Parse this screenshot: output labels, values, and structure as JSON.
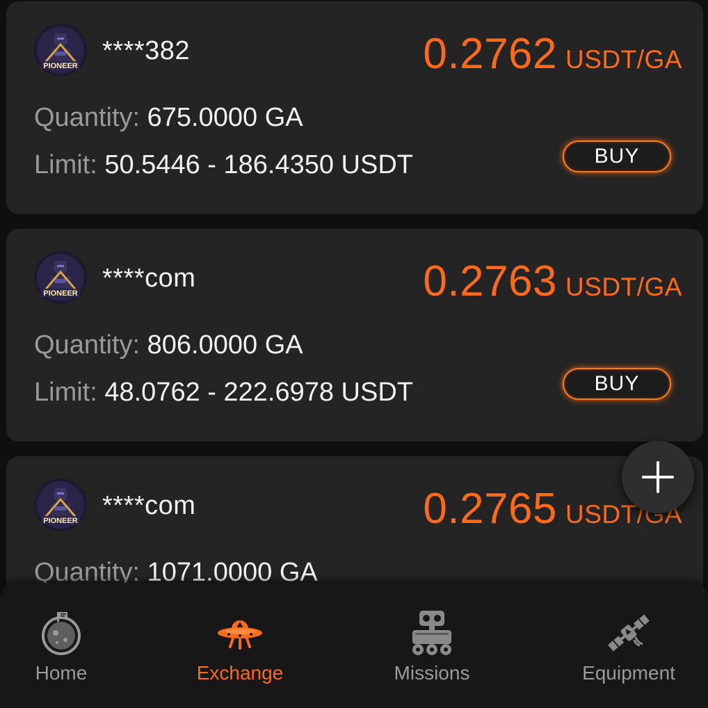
{
  "offers": [
    {
      "avatar_badge": "PIONEER",
      "username": "****382",
      "price": "0.2762",
      "price_unit": "USDT/GA",
      "quantity_label": "Quantity:",
      "quantity_value": "675.0000 GA",
      "limit_label": "Limit:",
      "limit_value": "50.5446 - 186.4350 USDT",
      "buy_label": "BUY"
    },
    {
      "avatar_badge": "PIONEER",
      "username": "****com",
      "price": "0.2763",
      "price_unit": "USDT/GA",
      "quantity_label": "Quantity:",
      "quantity_value": "806.0000 GA",
      "limit_label": "Limit:",
      "limit_value": "48.0762 - 222.6978 USDT",
      "buy_label": "BUY"
    },
    {
      "avatar_badge": "PIONEER",
      "username": "****com",
      "price": "0.2765",
      "price_unit": "USDT/GA",
      "quantity_label": "Quantity:",
      "quantity_value": "1071.0000 GA"
    }
  ],
  "fab": {
    "icon": "plus-icon"
  },
  "nav": {
    "items": [
      {
        "label": "Home",
        "icon": "planet-icon",
        "active": false
      },
      {
        "label": "Exchange",
        "icon": "ufo-icon",
        "active": true
      },
      {
        "label": "Missions",
        "icon": "robot-icon",
        "active": false
      },
      {
        "label": "Equipment",
        "icon": "satellite-icon",
        "active": false
      }
    ],
    "active_color": "#ff6a1a",
    "inactive_color": "#9a9a9a"
  },
  "colors": {
    "accent": "#ff6a1a",
    "card_background": "#242424",
    "page_background": "#0f0f0f"
  }
}
